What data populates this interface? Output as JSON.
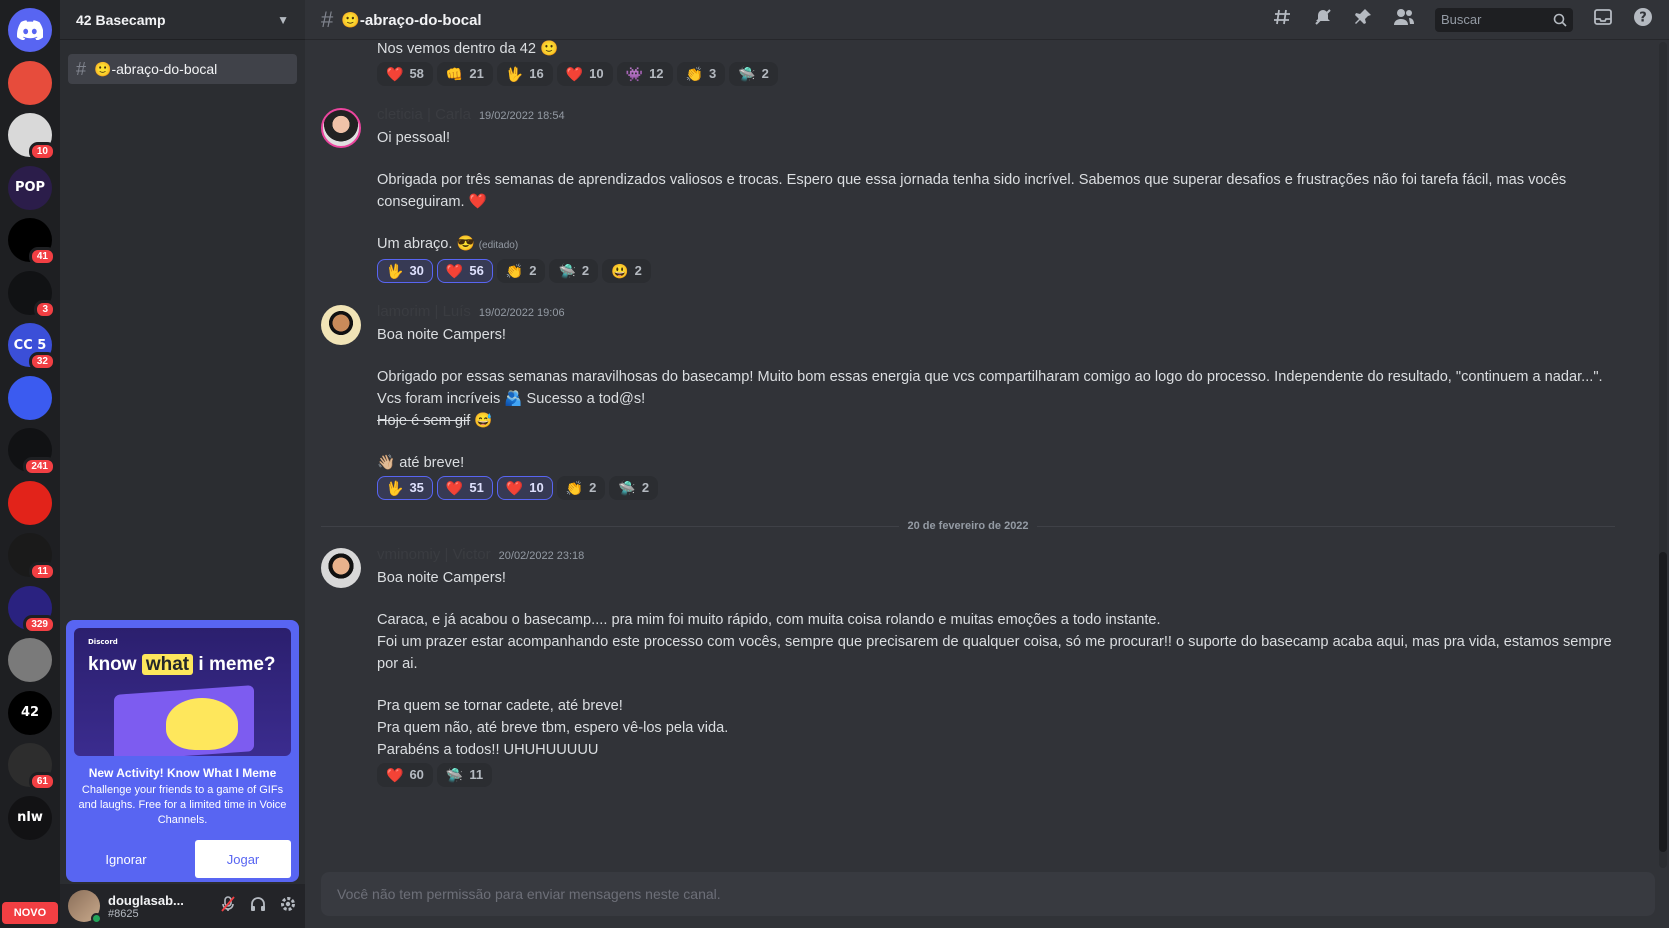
{
  "rail": {
    "servers": [
      {
        "label": "",
        "badge": "",
        "color": "#5865f2"
      },
      {
        "label": "",
        "badge": "",
        "color": "#e74c3c"
      },
      {
        "label": "",
        "badge": "10",
        "color": "#d9d9d9"
      },
      {
        "label": "POP",
        "badge": "",
        "color": "#2b1d4a"
      },
      {
        "label": "",
        "badge": "41",
        "color": "#000000"
      },
      {
        "label": "",
        "badge": "3",
        "color": "#111214"
      },
      {
        "label": "CC 5",
        "badge": "32",
        "color": "#3b4fd8"
      },
      {
        "label": "",
        "badge": "",
        "color": "#3b5bf0"
      },
      {
        "label": "",
        "badge": "241",
        "color": "#111214"
      },
      {
        "label": "",
        "badge": "",
        "color": "#e2231a"
      },
      {
        "label": "",
        "badge": "11",
        "color": "#1a1a1a"
      },
      {
        "label": "",
        "badge": "329",
        "color": "#2a2280"
      },
      {
        "label": "",
        "badge": "",
        "color": "#7a7a7a"
      },
      {
        "label": "42",
        "badge": "",
        "color": "#000000"
      },
      {
        "label": "",
        "badge": "61",
        "color": "#2d2d2d"
      },
      {
        "label": "nlw",
        "badge": "",
        "color": "#121214"
      }
    ],
    "novo": "NOVO"
  },
  "sidebar": {
    "guild_name": "42 Basecamp",
    "channel": "🙂-abraço-do-bocal",
    "promo": {
      "brand": "Discord",
      "art_title_1": "know",
      "art_title_hl": "what",
      "art_title_2": "i meme?",
      "title": "New Activity! Know What I Meme",
      "desc": "Challenge your friends to a game of GIFs and laughs. Free for a limited time in Voice Channels.",
      "ignore": "Ignorar",
      "play": "Jogar"
    },
    "user": {
      "name": "douglasab...",
      "tag": "#8625"
    }
  },
  "topbar": {
    "channel_title": "🙂-abraço-do-bocal",
    "search_placeholder": "Buscar"
  },
  "messages": {
    "intro": {
      "text": "Nos vemos dentro da 42 🙂",
      "reactions": [
        {
          "emoji": "❤️",
          "count": "58"
        },
        {
          "emoji": "👊",
          "count": "21"
        },
        {
          "emoji": "🖖",
          "count": "16"
        },
        {
          "emoji": "❤️",
          "count": "10"
        },
        {
          "emoji": "👾",
          "count": "12"
        },
        {
          "emoji": "👏",
          "count": "3"
        },
        {
          "emoji": "🛸",
          "count": "2"
        }
      ]
    },
    "m1": {
      "author": "cleticia | Carla",
      "time": "19/02/2022 18:54",
      "l1": "Oi pessoal!",
      "l2": "Obrigada por três semanas de aprendizados valiosos e trocas. Espero que essa jornada tenha sido incrível. Sabemos que superar desafios e frustrações não foi tarefa fácil, mas vocês conseguiram. ❤️",
      "l3": "Um abraço. 😎",
      "edited": "(editado)",
      "reactions": [
        {
          "emoji": "🖖",
          "count": "30"
        },
        {
          "emoji": "❤️",
          "count": "56"
        },
        {
          "emoji": "👏",
          "count": "2"
        },
        {
          "emoji": "🛸",
          "count": "2"
        },
        {
          "emoji": "😃",
          "count": "2"
        }
      ]
    },
    "m2": {
      "author": "lamorim | Luís",
      "time": "19/02/2022 19:06",
      "l1": "Boa noite Campers!",
      "l2": "Obrigado por essas semanas maravilhosas do basecamp! Muito bom essas energia que vcs compartilharam comigo ao logo do processo. Independente do resultado, \"continuem a nadar...\".",
      "l3": "Vcs foram incríveis 🫂 Sucesso a tod@s!",
      "l4": "Hoje é sem gif",
      "l4b": "😅",
      "l5": "👋🏼 até breve!",
      "reactions": [
        {
          "emoji": "🖖",
          "count": "35"
        },
        {
          "emoji": "❤️",
          "count": "51"
        },
        {
          "emoji": "❤️",
          "count": "10"
        },
        {
          "emoji": "👏",
          "count": "2"
        },
        {
          "emoji": "🛸",
          "count": "2"
        }
      ]
    },
    "date_divider": "20 de fevereiro de 2022",
    "m3": {
      "author": "vminomiy | Victor",
      "time": "20/02/2022 23:18",
      "l1": "Boa noite Campers!",
      "l2": "Caraca, e já acabou o basecamp.... pra mim foi muito rápido, com muita coisa rolando e muitas emoções a todo instante.",
      "l3": "Foi um prazer estar acompanhando este processo com vocês, sempre que precisarem de qualquer coisa, só me procurar!! o suporte do basecamp acaba aqui, mas pra vida, estamos sempre por ai.",
      "l4": "Pra quem se tornar cadete, até breve!",
      "l5": "Pra quem não, até breve tbm, espero vê-los pela vida.",
      "l6": "Parabéns a todos!! UHUHUUUUU",
      "reactions": [
        {
          "emoji": "❤️",
          "count": "60"
        },
        {
          "emoji": "🛸",
          "count": "11"
        }
      ]
    }
  },
  "composer": {
    "placeholder": "Você não tem permissão para enviar mensagens neste canal."
  }
}
